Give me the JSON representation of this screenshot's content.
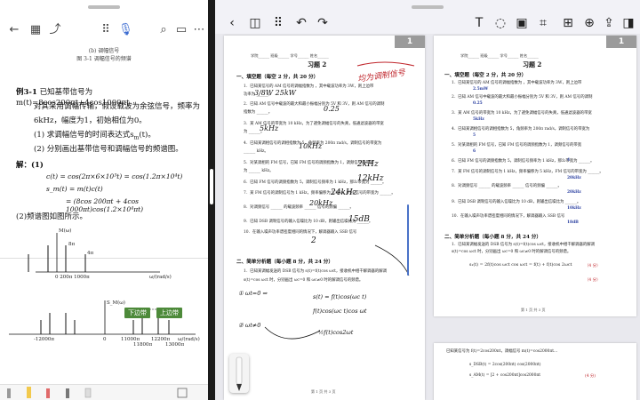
{
  "left": {
    "toolbar_icons": [
      "back-icon",
      "grid-icon",
      "share-icon",
      "apps-icon",
      "mic-icon",
      "search-icon",
      "reader-icon",
      "more-icon"
    ],
    "caption_top_1": "(b) 调幅信号",
    "caption_top_2": "图 3-1  调幅信号的频谱",
    "example_label": "例3-1",
    "example_line1": "已知基带信号为 m(t)=8cos200πt+4cos1000πt",
    "example_line2": "对其采用调幅传输，假设载波为余弦信号，频率为",
    "example_line3": "6kHz，幅度为1，初始相位为0。",
    "example_line4": "(1) 求调幅信号的时间表达式s",
    "example_line4b": "m",
    "example_line4c": "(t)。",
    "example_line5": "(2) 分别画出基带信号和调幅信号的频谱图。",
    "solution_label": "解：(1)",
    "formula1": "c(t) = cos(2π×6×10³t) = cos(1.2π×10⁴t)",
    "formula2": "s_m(t) = m(t)c(t)",
    "formula3": "= (8cos 200πt + 4cos 1000πt)cos(1.2×10⁴πt)",
    "part2": "(2)频谱图如图所示。",
    "figure_caption": "图 3-4  例十一图",
    "tag_lower": "下边带",
    "tag_upper": "上边带",
    "fig_labels": {
      "m_omega": "M(ω)",
      "eight_pi_a": "8π",
      "four_pi": "4π",
      "ticks_top": "0  200π  1000π",
      "omega_top": "ω/(rad/s)",
      "s_omega": "S_M(ω)",
      "two_pi": "2π",
      "minus_freq": "-12000π",
      "zero": "0",
      "f11000": "11000π",
      "f11800": "11800π",
      "f12200": "12200π",
      "f13000": "13000π",
      "omega_bot": "ω/(rad/s)"
    }
  },
  "right": {
    "toolbar_icons": [
      "back-icon",
      "sidebar-icon",
      "grid-icon",
      "undo-icon",
      "redo-icon",
      "text-tool-icon",
      "lasso-icon",
      "image-icon",
      "crop-icon",
      "add-page-icon",
      "lock-icon",
      "share-icon",
      "panel-icon"
    ],
    "page_badge": "1",
    "page_badge_right": "1",
    "doc_title": "习题 2",
    "header_fields": "学院______ 班级______ 学号______ 姓名______",
    "sec1": "一、填空题（每空 2 分，共 20 分）",
    "q_lines": [
      "1．已知某信号的 AM 信号的调幅指数为 ，其中载波功率为 3W，则上边带",
      "   功率为 ______。",
      "2．已知 AM 信号中载波的最大和最小振幅分别为 5V 和 3V，则 AM 信号的调制",
      "   指数为 ______。",
      "3．某 AM 信号的带宽为 10 kHz，为了避免调幅信号的失真，低通滤波器的带宽",
      "   为 ______。",
      "4．已知某调相信号的调相指数为 5，角频率为 200π rad/s，调制信号的带宽为",
      "   ______ kHz。",
      "5．对某调相的 FM 信号，已知 FM 信号的调频指数为 1，调频信号的带宽",
      "   为 ______ kHz。",
      "6．已知 FM 信号的调频指数为 5，调制信号频率为 1 kHz，那么带宽为 ______。",
      "7．某 FM 信号的调制信号为 1 kHz，频率偏移为 5 kHz，FM 信号的带宽为 ______。",
      "8．对调频信号 ______ 的载波频率 ______ 信号的频偏 ______。",
      "9．已知 DSB 调制信号的输入信噪比为 10 dB，则输出信噪比为 ______。",
      "10．在输入噪声功率谱密度相同的情况下，解调器输入 SSB 信号"
    ],
    "sec2": "二、简单分析题（每小题 8 分，共 24 分）",
    "sec2_lines": [
      "1．已知某调幅发送的 DSB 信号为 s(t)=f(t)cos ωct，接收机中相干解调器的解调",
      "   s(t)=cos ωct 时，分别画出 ωc=0 和 ωc≠0 时的解调信号的频谱。"
    ],
    "hand_answers": [
      "3/8W  25kW",
      "0.25",
      "5kHz",
      "10kHz",
      "2kHz",
      "12kHz",
      "24kHz",
      "20kHz",
      "15dB",
      "2"
    ],
    "hand_note": "均为调制信号",
    "hand_bottom": [
      "① ωt=0  ⇒",
      "② ωt≠0",
      "s(t) = f(t)cos(ωc t)",
      "f(t)cos(ωc t)cos ωt",
      "½f(t)cos2ωt"
    ],
    "footer_left": "第 1 页  共 3 页",
    "footer_right": "第 1 页  共 3 页",
    "r_title": "习题 2",
    "r_sec1": "一、填空题（每空 2 分，共 20 分）",
    "r_answers": [
      "2.5mW",
      "0.25",
      "5kHz",
      "5",
      "6",
      "4",
      "20kHz",
      "20kHz",
      "10kHz",
      "18dB"
    ],
    "r_sec2": "二、简单分析题（每小题 8 分，共 24 分）",
    "r_formula": "s₁(t) = 2f(t)cos ωct cos ωct = f(t) + f(t)cos 2ωct",
    "r_points": [
      "（4 分）",
      "（4 分）"
    ],
    "r_bottom_title": "已知某信号为 f(t)=2cos200πt，调幅信号 m(t)=cos2000πt...",
    "r_bottom_lines": [
      "s_DSB(t) = 2cos(200πt) cos(2000πt)",
      "s_AM(t) = [2 + cos200πt]cos2000πt",
      "(4 分)"
    ]
  }
}
